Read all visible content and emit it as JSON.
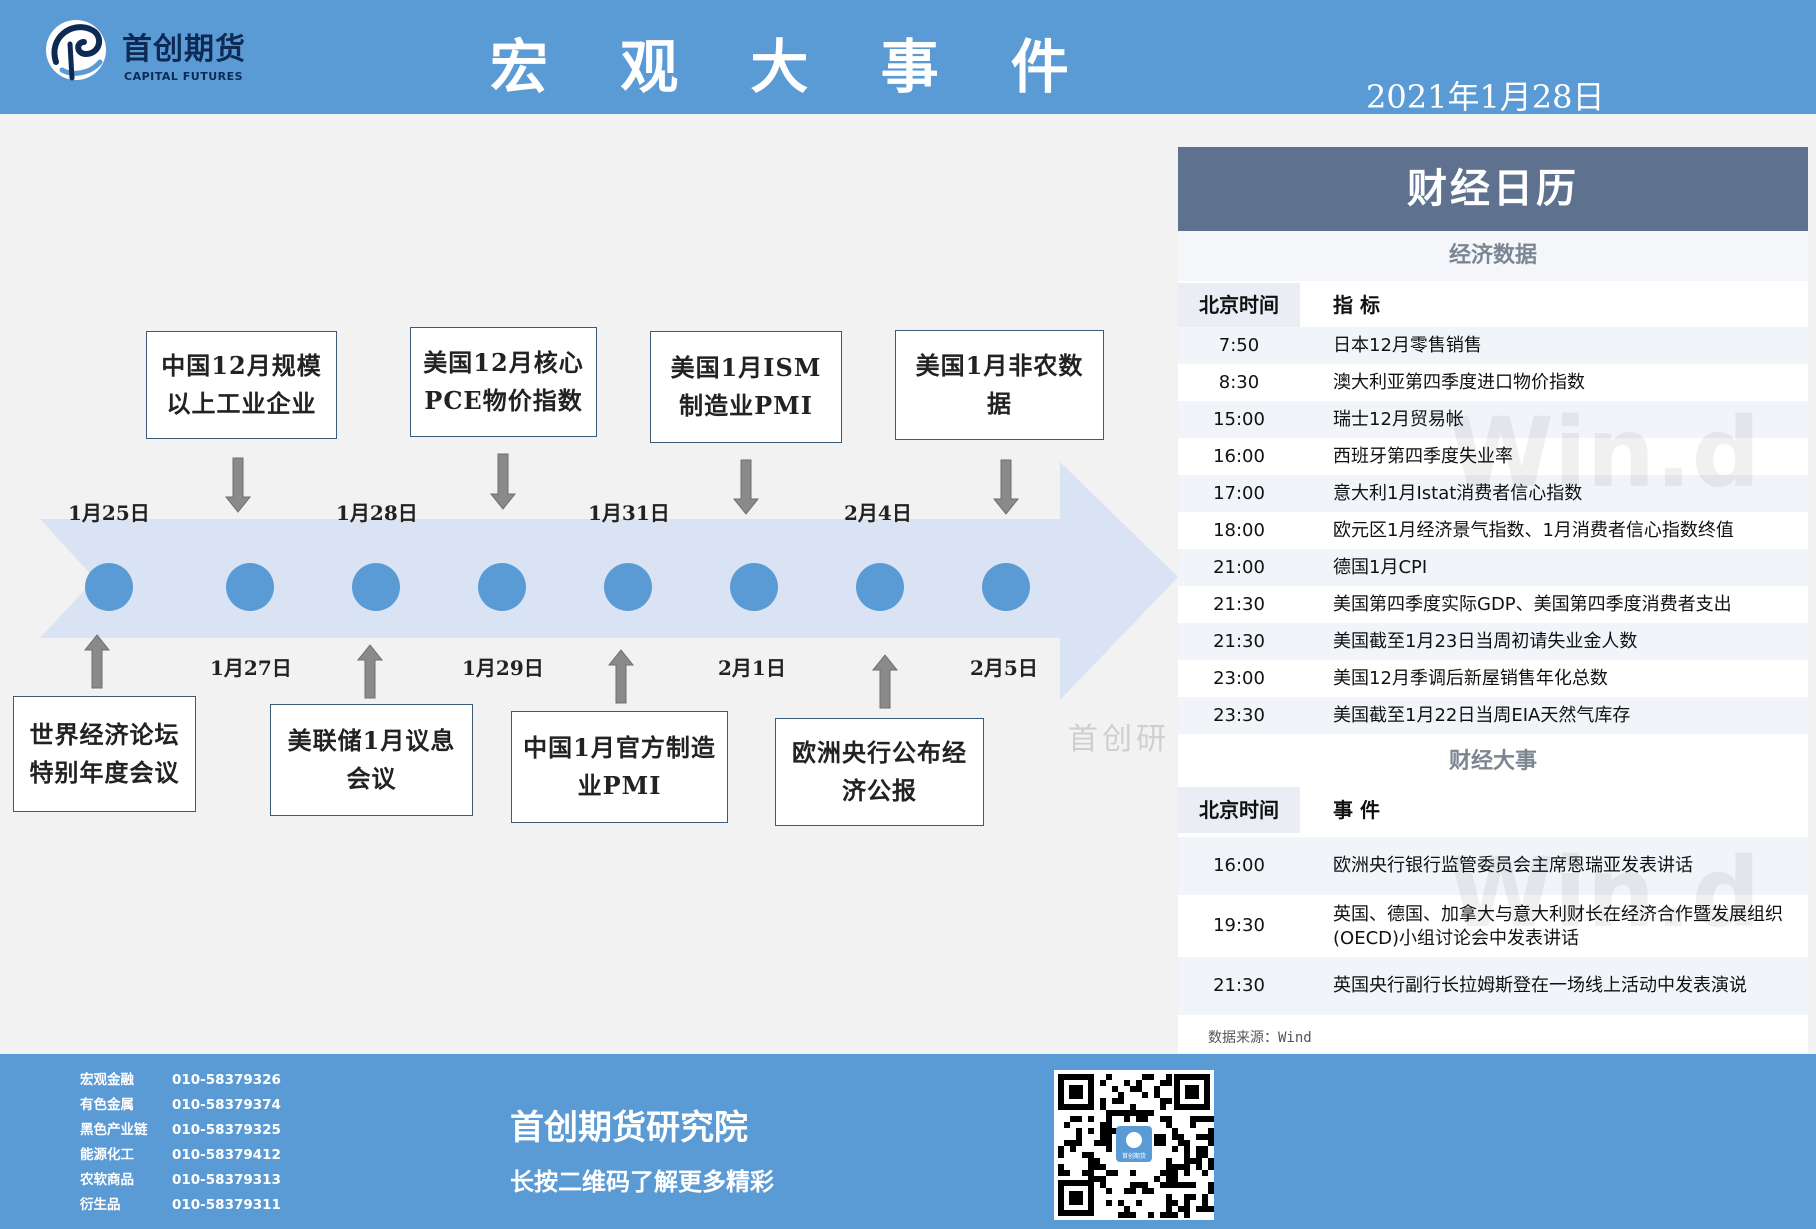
{
  "header": {
    "logo_cn": "首创期货",
    "logo_en": "CAPITAL FUTURES",
    "title": "宏 观 大 事 件",
    "date": "2021年1月28日",
    "colors": {
      "banner": "#5b9bd5",
      "text": "#ffffff"
    }
  },
  "timeline": {
    "dates": [
      "1月25日",
      "1月27日",
      "1月28日",
      "1月29日",
      "1月31日",
      "2月1日",
      "2月4日",
      "2月5日"
    ],
    "events_top": [
      {
        "text": "中国12月规模以上工业企业"
      },
      {
        "text": "美国12月核心PCE物价指数"
      },
      {
        "text": "美国1月ISM制造业PMI"
      },
      {
        "text": "美国1月非农数据"
      }
    ],
    "events_bottom": [
      {
        "text": "世界经济论坛特别年度会议"
      },
      {
        "text": "美联储1月议息会议"
      },
      {
        "text": "中国1月官方制造业PMI"
      },
      {
        "text": "欧洲央行公布经济公报"
      }
    ],
    "watermark": "首创研",
    "colors": {
      "arrow": "#dae3f3",
      "dot": "#5b9bd5",
      "pointer": "#8a8a8a"
    }
  },
  "calendar": {
    "title": "财经日历",
    "econ": {
      "section_title": "经济数据",
      "header_time": "北京时间",
      "header_item": "指 标",
      "rows": [
        {
          "time": "7:50",
          "item": "日本12月零售销售"
        },
        {
          "time": "8:30",
          "item": "澳大利亚第四季度进口物价指数"
        },
        {
          "time": "15:00",
          "item": "瑞士12月贸易帐"
        },
        {
          "time": "16:00",
          "item": "西班牙第四季度失业率"
        },
        {
          "time": "17:00",
          "item": "意大利1月Istat消费者信心指数"
        },
        {
          "time": "18:00",
          "item": "欧元区1月经济景气指数、1月消费者信心指数终值"
        },
        {
          "time": "21:00",
          "item": "德国1月CPI"
        },
        {
          "time": "21:30",
          "item": "美国第四季度实际GDP、美国第四季度消费者支出"
        },
        {
          "time": "21:30",
          "item": "美国截至1月23日当周初请失业金人数"
        },
        {
          "time": "23:00",
          "item": "美国12月季调后新屋销售年化总数"
        },
        {
          "time": "23:30",
          "item": "美国截至1月22日当周EIA天然气库存"
        }
      ]
    },
    "events": {
      "section_title": "财经大事",
      "header_time": "北京时间",
      "header_item": "事 件",
      "rows": [
        {
          "time": "16:00",
          "item": "欧洲央行银行监管委员会主席恩瑞亚发表讲话"
        },
        {
          "time": "19:30",
          "item": "英国、德国、加拿大与意大利财长在经济合作暨发展组织(OECD)小组讨论会中发表讲话"
        },
        {
          "time": "21:30",
          "item": "英国央行副行长拉姆斯登在一场线上活动中发表演说"
        }
      ]
    },
    "source": "数据来源：Wind",
    "watermark": "Win.d",
    "colors": {
      "head": "#5e7290",
      "alt_row": "#f1f4f9"
    }
  },
  "footer": {
    "contacts": [
      {
        "name": "宏观金融",
        "phone": "010-58379326"
      },
      {
        "name": "有色金属",
        "phone": "010-58379374"
      },
      {
        "name": "黑色产业链",
        "phone": "010-58379325"
      },
      {
        "name": "能源化工",
        "phone": "010-58379412"
      },
      {
        "name": "农软商品",
        "phone": "010-58379313"
      },
      {
        "name": "衍生品",
        "phone": "010-58379311"
      }
    ],
    "org_name": "首创期货研究院",
    "org_sub": "长按二维码了解更多精彩",
    "qr_center_label": "首创期货"
  }
}
